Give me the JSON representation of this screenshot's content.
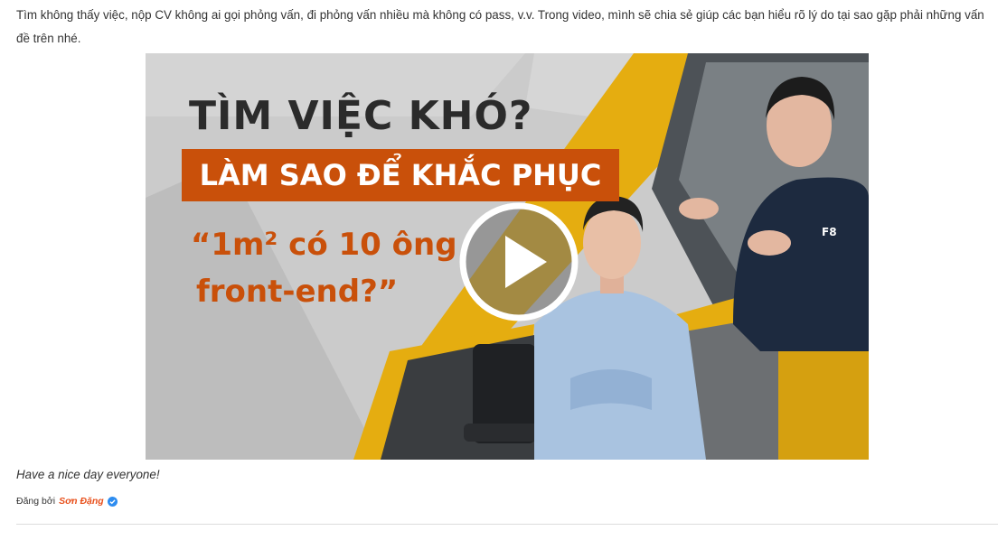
{
  "post": {
    "intro_text": "Tìm không thấy việc, nộp CV không ai gọi phỏng vấn, đi phỏng vấn nhiều mà không có pass, v.v. Trong video, mình sẽ chia sẻ giúp các bạn hiểu rõ lý do tại sao gặp phải những vấn đề trên nhé.",
    "video_thumbnail": {
      "headline": "TÌM VIỆC KHÓ?",
      "banner": "LÀM SAO ĐỂ KHẮC PHỤC",
      "quote_line1": "“1m² có 10 ông",
      "quote_line2": "front-end?”",
      "shirt_logo": "F8",
      "play_icon": "play-icon"
    },
    "closing_text": "Have a nice day everyone!",
    "byline": {
      "prefix": "Đăng bởi",
      "author": "Sơn Đặng",
      "verified_icon": "verified-check-icon"
    }
  },
  "colors": {
    "accent_orange": "#c9500a",
    "frame_yellow": "#e5ad10",
    "author_link": "#e8501c",
    "verified_blue": "#2d8cf0"
  }
}
